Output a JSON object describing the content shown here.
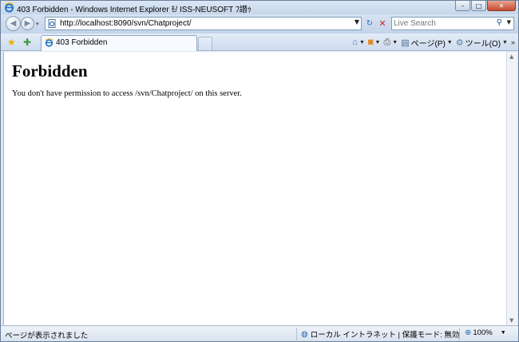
{
  "window": {
    "title": "403 Forbidden - Windows Internet Explorer ﾓ/ ISS-NEUSOFT ﾌ譛ｩ",
    "icon": "ie-icon",
    "controls": {
      "minimize": "–",
      "maximize": "□",
      "close": "✕"
    }
  },
  "nav": {
    "back_glyph": "◀",
    "forward_glyph": "▶",
    "history_glyph": "▾",
    "address": "http://localhost:8090/svn/Chatproject/",
    "address_drop": "▼",
    "refresh_glyph": "↻",
    "stop_glyph": "✕"
  },
  "search": {
    "placeholder": "Live Search",
    "icon_glyph": "⚲",
    "drop": "▼"
  },
  "tabs": [
    {
      "label": "403 Forbidden",
      "active": true
    }
  ],
  "commands": {
    "home_glyph": "⌂",
    "feeds_glyph": "◙",
    "print_glyph": "⎙",
    "page_glyph": "▤",
    "page_label": "ページ(P)",
    "tools_glyph": "⚙",
    "tools_label": "ツール(O)",
    "arrow": "▼",
    "more": "»"
  },
  "favorites": {
    "star_glyph": "★",
    "add_glyph": "✚"
  },
  "content": {
    "heading": "Forbidden",
    "message": "You don't have permission to access /svn/Chatproject/ on this server."
  },
  "status": {
    "text": "ページが表示されました",
    "zone_glyph": "◍",
    "zone": "ローカル イントラネット | 保護モード: 無効",
    "zoom_glyph": "⊕",
    "zoom": "100%",
    "zoom_drop": "▼"
  },
  "colors": {
    "chrome": "#c9d8ec",
    "border": "#6b7f99",
    "close_button": "#c44a2c"
  }
}
